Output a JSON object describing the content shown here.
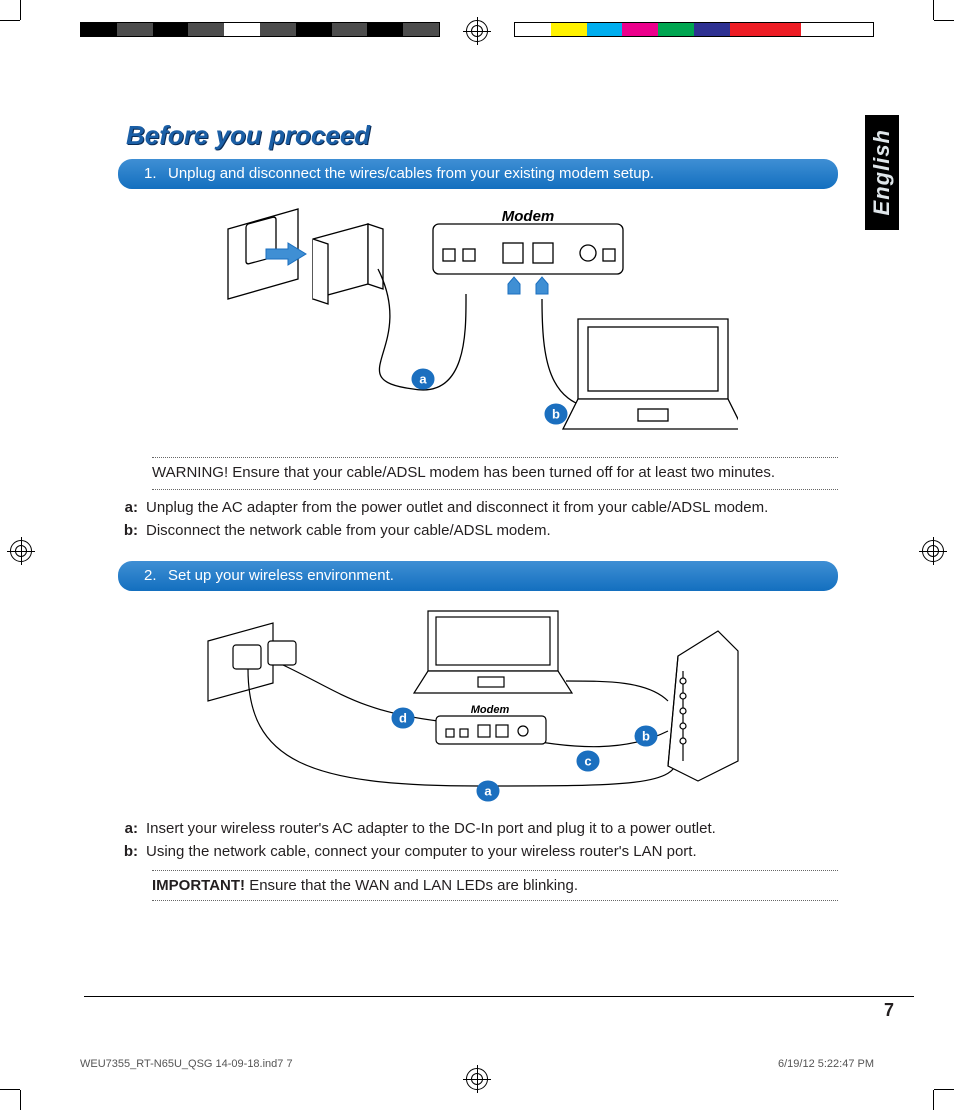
{
  "language_tab": "English",
  "heading": "Before you proceed",
  "step1": {
    "number": "1.",
    "text": "Unplug and disconnect the wires/cables from your existing modem setup.",
    "diagram": {
      "modem_label": "Modem",
      "bubble_a": "a",
      "bubble_b": "b"
    },
    "warning": "WARNING!  Ensure that your cable/ADSL modem has been turned off for at least two minutes.",
    "sub_a_label": "a:",
    "sub_a_text": "Unplug the AC adapter from the power outlet and disconnect it from your cable/ADSL modem.",
    "sub_b_label": "b:",
    "sub_b_text": "Disconnect the network cable from your cable/ADSL modem."
  },
  "step2": {
    "number": "2.",
    "text": "Set up your wireless environment.",
    "diagram": {
      "modem_label": "Modem",
      "bubble_a": "a",
      "bubble_b": "b",
      "bubble_c": "c",
      "bubble_d": "d"
    },
    "sub_a_label": "a:",
    "sub_a_text": "Insert your wireless router's AC adapter to the DC-In port and plug it to a power outlet.",
    "sub_b_label": "b:",
    "sub_b_text": "Using the network cable, connect your computer to your wireless router's LAN port.",
    "important_label": "IMPORTANT!",
    "important_text": "  Ensure that the WAN and LAN LEDs are blinking."
  },
  "page_number": "7",
  "slug_left": "WEU7355_RT-N65U_QSG 14-09-18.ind7   7",
  "slug_right": "6/19/12   5:22:47 PM",
  "colorbar_left": [
    "#000000",
    "#4d4d4d",
    "#000000",
    "#4d4d4d",
    "#ffffff",
    "#4d4d4d",
    "#000000",
    "#4d4d4d",
    "#000000",
    "#4d4d4d"
  ],
  "colorbar_right": [
    "#ffffff",
    "#fff200",
    "#00aeef",
    "#ec008c",
    "#00a651",
    "#2e3192",
    "#ed1c24",
    "#ed1c24",
    "#ffffff",
    "#ffffff"
  ]
}
